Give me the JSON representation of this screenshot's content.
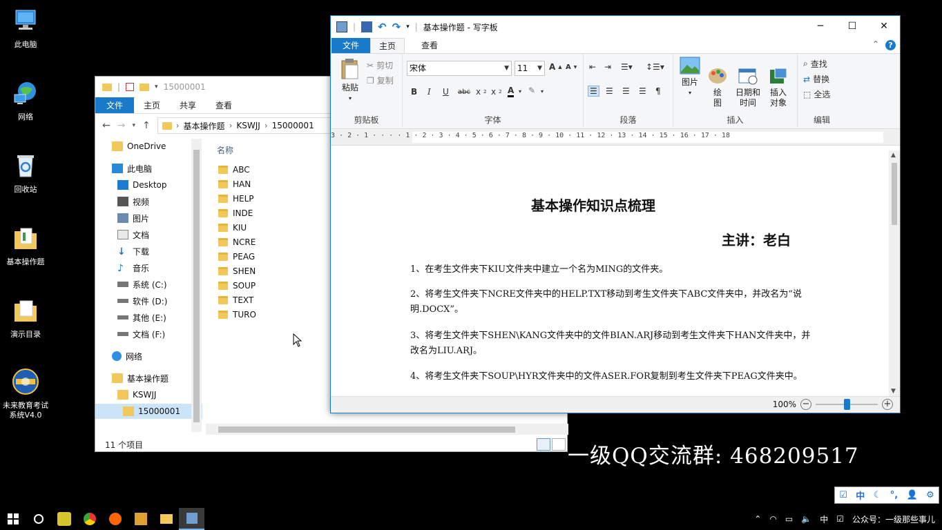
{
  "colors": {
    "accent": "#1979ca",
    "folder": "#f3c85a",
    "desktop_bg": "#000000"
  },
  "desktop": {
    "icons": [
      {
        "label": "此电脑",
        "icon": "computer-icon"
      },
      {
        "label": "网络",
        "icon": "network-globe-icon"
      },
      {
        "label": "回收站",
        "icon": "recycle-bin-icon"
      },
      {
        "label": "基本操作题",
        "icon": "folder-icon"
      },
      {
        "label": "演示目录",
        "icon": "folder-icon"
      },
      {
        "label": "未来教育考试系统V4.0",
        "icon": "exam-system-logo-icon"
      }
    ],
    "overlay": {
      "line1": "一级QQ交流群: 468209517"
    }
  },
  "explorer": {
    "title": "15000001",
    "tabs": {
      "file": "文件",
      "home": "主页",
      "share": "共享",
      "view": "查看"
    },
    "address": {
      "p1": "基本操作题",
      "p2": "KSWJJ",
      "p3": "15000001"
    },
    "nav": {
      "onedrive": "OneDrive",
      "thispc": "此电脑",
      "desktop": "Desktop",
      "videos": "视频",
      "pictures": "图片",
      "documents": "文档",
      "downloads": "下载",
      "music": "音乐",
      "drive_c": "系统 (C:)",
      "drive_d": "软件 (D:)",
      "drive_e": "其他 (E:)",
      "drive_f": "文档 (F:)",
      "network": "网络",
      "basic": "基本操作题",
      "kswjj": "KSWJJ",
      "current": "15000001"
    },
    "column_header": "名称",
    "files": [
      "ABC",
      "HAN",
      "HELP",
      "INDE",
      "KIU",
      "NCRE",
      "PEAG",
      "SHEN",
      "SOUP",
      "TEXT",
      "TURO"
    ],
    "status": "11 个项目"
  },
  "wordpad": {
    "title": "基本操作题 - 写字板",
    "tabs": {
      "file": "文件",
      "home": "主页",
      "view": "查看"
    },
    "ribbon": {
      "paste": "粘贴",
      "cut": "剪切",
      "copy": "复制",
      "clipboard": "剪贴板",
      "font_name": "宋体",
      "font_size": "11",
      "font_group": "字体",
      "paragraph_group": "段落",
      "picture": "图片",
      "paint": "绘\n图",
      "datetime": "日期和\n时间",
      "insert_object": "插入\n对象",
      "insert_group": "插入",
      "find": "查找",
      "replace": "替换",
      "select_all": "全选",
      "edit_group": "编辑"
    },
    "ruler": "3 · 2 · 1 · · · · 1 · 2 · 3 · 4 · 5 · 6 · 7 · 8 · 9 · 10 · 11 · 12 · 13 · 14 · 15 · 16 · 17 · 18",
    "doc": {
      "title": "基本操作知识点梳理",
      "author": "主讲：老白",
      "items": [
        "1、在考生文件夹下KIU文件夹中建立一个名为MING的文件夹。",
        "2、将考生文件夹下NCRE文件夹中的HELP.TXT移动到考生文件夹下ABC文件夹中，并改名为“说明.DOCX”。",
        "3、将考生文件夹下SHEN\\KANG文件夹中的文件BIAN.ARJ移动到考生文件夹下HAN文件夹中，并改名为LIU.ARJ。",
        "4、将考生文件夹下SOUP\\HYR文件夹中的文件ASER.FOR复制到考生文件夹下PEAG文件夹中。"
      ]
    },
    "zoom": "100%",
    "zoom_level": 0.5
  },
  "ime": {
    "lang": "中"
  },
  "tray": {
    "lang": "中",
    "public_account": "公众号：一级那些事儿"
  }
}
